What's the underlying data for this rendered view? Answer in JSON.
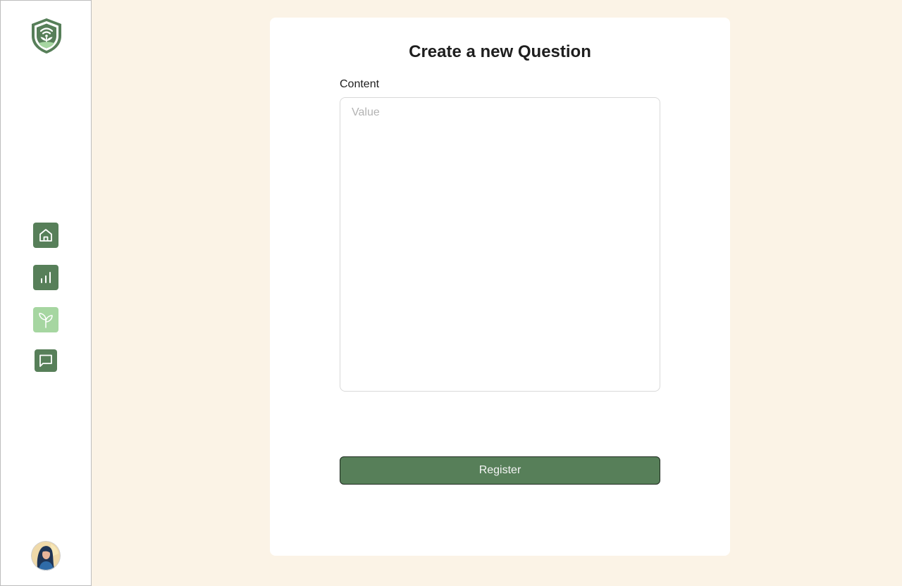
{
  "sidebar": {
    "logo": {
      "icon": "shield-plant-wifi-icon"
    },
    "nav": [
      {
        "icon": "home-icon",
        "active": false
      },
      {
        "icon": "bar-chart-icon",
        "active": false
      },
      {
        "icon": "sprout-icon",
        "active": true
      },
      {
        "icon": "chat-icon",
        "active": false
      }
    ],
    "avatar": {
      "icon": "user-avatar"
    }
  },
  "form": {
    "title": "Create a new Question",
    "content_label": "Content",
    "content_placeholder": "Value",
    "content_value": "",
    "submit_label": "Register"
  },
  "colors": {
    "background": "#FBF3E6",
    "primary": "#577F59",
    "active_nav": "#A6D6A1",
    "card": "#FFFFFF"
  }
}
